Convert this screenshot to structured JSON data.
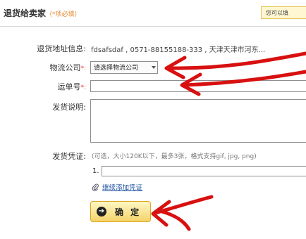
{
  "header": {
    "title": "退货给卖家",
    "hint": "（*项必填）",
    "notice": "您可以填"
  },
  "form": {
    "address_label": "退货地址信息:",
    "address_value": "fdsafsdaf , 0571-88155188-333 , 天津天津市河东...",
    "logistics_label": "物流公司",
    "logistics_required": "*:",
    "logistics_selected": "请选择物流公司",
    "tracking_label": "运单号",
    "tracking_required": "*:",
    "tracking_value": "",
    "description_label": "发货说明:",
    "description_value": "",
    "proof_label": "发货凭证:",
    "proof_hint": "(可选，大小120K以下，最多3张，格式支持gif, jpg, png)",
    "file_index": "1.",
    "file_value": "",
    "add_proof_link": "继续添加凭证",
    "confirm_label": "确 定"
  },
  "annotations": {
    "arrow_color": "#d81010"
  }
}
